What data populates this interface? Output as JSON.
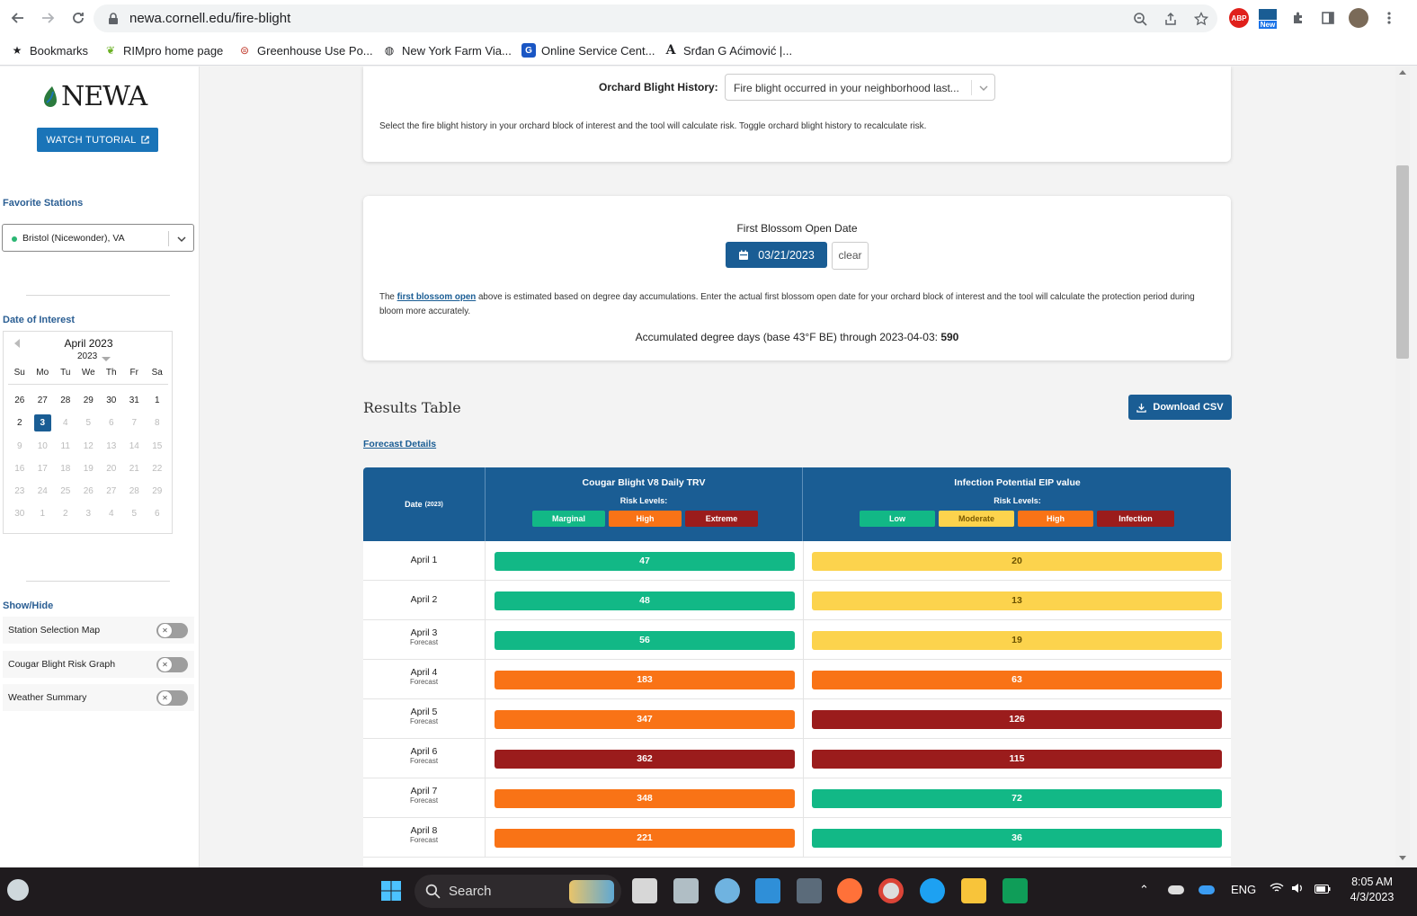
{
  "browser": {
    "url": "newa.cornell.edu/fire-blight",
    "bookmarks": [
      {
        "label": "Bookmarks",
        "icon": "star-icon"
      },
      {
        "label": "RIMpro home page",
        "icon": "leaf-icon"
      },
      {
        "label": "Greenhouse Use Po...",
        "icon": "badge-icon"
      },
      {
        "label": "New York Farm Via...",
        "icon": "globe-icon"
      },
      {
        "label": "Online Service Cent...",
        "icon": "g-icon"
      },
      {
        "label": "Srđan G Aćimović |...",
        "icon": "a-icon"
      }
    ],
    "ext_abp": "ABP",
    "ext_new": "New"
  },
  "sidebar": {
    "logo_text": "NEWA",
    "tutorial_label": "WATCH TUTORIAL",
    "favorite_stations_heading": "Favorite Stations",
    "station_value": "Bristol (Nicewonder), VA",
    "date_heading": "Date of Interest",
    "calendar": {
      "month_label": "April 2023",
      "year_label": "2023",
      "dows": [
        "Su",
        "Mo",
        "Tu",
        "We",
        "Th",
        "Fr",
        "Sa"
      ],
      "days": [
        {
          "n": "26",
          "state": "normal"
        },
        {
          "n": "27",
          "state": "normal"
        },
        {
          "n": "28",
          "state": "normal"
        },
        {
          "n": "29",
          "state": "normal"
        },
        {
          "n": "30",
          "state": "normal"
        },
        {
          "n": "31",
          "state": "normal"
        },
        {
          "n": "1",
          "state": "normal"
        },
        {
          "n": "2",
          "state": "normal"
        },
        {
          "n": "3",
          "state": "selected"
        },
        {
          "n": "4",
          "state": "dim"
        },
        {
          "n": "5",
          "state": "dim"
        },
        {
          "n": "6",
          "state": "dim"
        },
        {
          "n": "7",
          "state": "dim"
        },
        {
          "n": "8",
          "state": "dim"
        },
        {
          "n": "9",
          "state": "dim"
        },
        {
          "n": "10",
          "state": "dim"
        },
        {
          "n": "11",
          "state": "dim"
        },
        {
          "n": "12",
          "state": "dim"
        },
        {
          "n": "13",
          "state": "dim"
        },
        {
          "n": "14",
          "state": "dim"
        },
        {
          "n": "15",
          "state": "dim"
        },
        {
          "n": "16",
          "state": "dim"
        },
        {
          "n": "17",
          "state": "dim"
        },
        {
          "n": "18",
          "state": "dim"
        },
        {
          "n": "19",
          "state": "dim"
        },
        {
          "n": "20",
          "state": "dim"
        },
        {
          "n": "21",
          "state": "dim"
        },
        {
          "n": "22",
          "state": "dim"
        },
        {
          "n": "23",
          "state": "dim"
        },
        {
          "n": "24",
          "state": "dim"
        },
        {
          "n": "25",
          "state": "dim"
        },
        {
          "n": "26",
          "state": "dim"
        },
        {
          "n": "27",
          "state": "dim"
        },
        {
          "n": "28",
          "state": "dim"
        },
        {
          "n": "29",
          "state": "dim"
        },
        {
          "n": "30",
          "state": "dim"
        },
        {
          "n": "1",
          "state": "dim"
        },
        {
          "n": "2",
          "state": "dim"
        },
        {
          "n": "3",
          "state": "dim"
        },
        {
          "n": "4",
          "state": "dim"
        },
        {
          "n": "5",
          "state": "dim"
        },
        {
          "n": "6",
          "state": "dim"
        }
      ]
    },
    "showhide_heading": "Show/Hide",
    "toggles": [
      {
        "label": "Station Selection Map",
        "on": false
      },
      {
        "label": "Cougar Blight Risk Graph",
        "on": false
      },
      {
        "label": "Weather Summary",
        "on": false
      }
    ]
  },
  "orchard": {
    "label": "Orchard Blight History:",
    "select_value": "Fire blight occurred in your neighborhood last...",
    "note": "Select the fire blight history in your orchard block of interest and the tool will calculate risk. Toggle orchard blight history to recalculate risk."
  },
  "first_blossom": {
    "title": "First Blossom Open Date",
    "date_value": "03/21/2023",
    "clear_label": "clear",
    "para_before": "The ",
    "para_link": "first blossom open",
    "para_after": " above is estimated based on degree day accumulations. Enter the actual first blossom open date for your orchard block of interest and the tool will calculate the protection period during bloom more accurately.",
    "accum_text": "Accumulated degree days (base 43°F BE) through 2023-04-03: ",
    "accum_value": "590"
  },
  "results": {
    "title": "Results Table",
    "download_label": "Download CSV",
    "forecast_link": "Forecast Details",
    "date_header": "Date",
    "date_header_year": "(2023)",
    "cougar_title": "Cougar Blight V8 Daily TRV",
    "eip_title": "Infection Potential EIP value",
    "risk_levels_label": "Risk Levels:",
    "cougar_levels": [
      {
        "label": "Marginal",
        "color": "#12b886"
      },
      {
        "label": "High",
        "color": "#f97316"
      },
      {
        "label": "Extreme",
        "color": "#9b1c1c"
      }
    ],
    "eip_levels": [
      {
        "label": "Low",
        "color": "#12b886"
      },
      {
        "label": "Moderate",
        "color": "#fcd34d"
      },
      {
        "label": "High",
        "color": "#f97316"
      },
      {
        "label": "Infection",
        "color": "#9b1c1c"
      }
    ],
    "rows": [
      {
        "date": "April 1",
        "sub": "",
        "trv": "47",
        "trv_level": "Marginal",
        "eip": "20",
        "eip_level": "Moderate"
      },
      {
        "date": "April 2",
        "sub": "",
        "trv": "48",
        "trv_level": "Marginal",
        "eip": "13",
        "eip_level": "Moderate"
      },
      {
        "date": "April 3",
        "sub": "Forecast",
        "trv": "56",
        "trv_level": "Marginal",
        "eip": "19",
        "eip_level": "Moderate"
      },
      {
        "date": "April 4",
        "sub": "Forecast",
        "trv": "183",
        "trv_level": "High",
        "eip": "63",
        "eip_level": "High"
      },
      {
        "date": "April 5",
        "sub": "Forecast",
        "trv": "347",
        "trv_level": "High",
        "eip": "126",
        "eip_level": "Infection"
      },
      {
        "date": "April 6",
        "sub": "Forecast",
        "trv": "362",
        "trv_level": "Extreme",
        "eip": "115",
        "eip_level": "Infection"
      },
      {
        "date": "April 7",
        "sub": "Forecast",
        "trv": "348",
        "trv_level": "High",
        "eip": "72",
        "eip_level": "Low"
      },
      {
        "date": "April 8",
        "sub": "Forecast",
        "trv": "221",
        "trv_level": "High",
        "eip": "36",
        "eip_level": "Low"
      }
    ]
  },
  "taskbar": {
    "search_placeholder": "Search",
    "lang": "ENG",
    "time": "8:05 AM",
    "date": "4/3/2023"
  }
}
